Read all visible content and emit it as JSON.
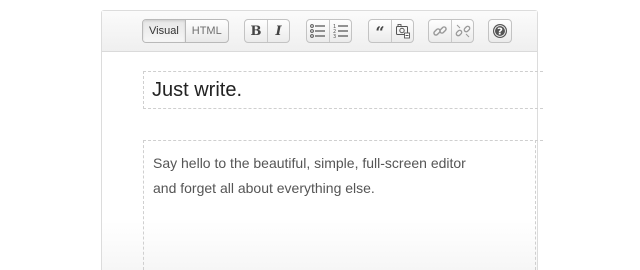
{
  "toolbar": {
    "mode_buttons": [
      {
        "label": "Visual",
        "active": true
      },
      {
        "label": "HTML",
        "active": false
      }
    ],
    "format_buttons": [
      {
        "icon": "bold-icon",
        "glyph": "B"
      },
      {
        "icon": "italic-icon",
        "glyph": "I"
      },
      {
        "icon": "bulleted-list-icon"
      },
      {
        "icon": "numbered-list-icon"
      },
      {
        "icon": "blockquote-icon",
        "glyph": "“"
      },
      {
        "icon": "insert-media-icon"
      },
      {
        "icon": "insert-link-icon"
      },
      {
        "icon": "remove-link-icon"
      },
      {
        "icon": "help-icon"
      }
    ]
  },
  "editor": {
    "title": "Just write.",
    "body_line_1": "Say hello to the beautiful, simple, full-screen editor",
    "body_line_2": "and forget all about everything else."
  },
  "colors": {
    "border": "#dcdcdc",
    "toolbar_bg": "#f2f2f2",
    "text": "#222222",
    "body_text": "#555555"
  }
}
